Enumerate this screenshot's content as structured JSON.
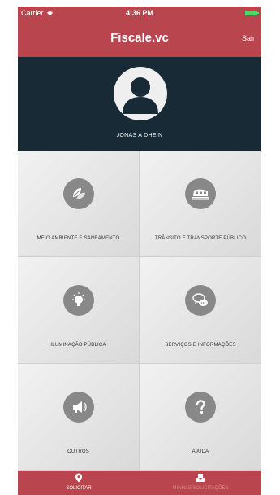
{
  "status_bar": {
    "carrier": "Carrier",
    "time": "4:36 PM"
  },
  "nav": {
    "title": "Fiscale.vc",
    "logout_label": "Sair"
  },
  "profile": {
    "name": "JONAS A DHEIN"
  },
  "categories": [
    {
      "label": "MEIO AMBIENTE E SANEAMENTO",
      "icon": "leaves-icon"
    },
    {
      "label": "TRÂNSITO E TRANSPORTE PÚBLICO",
      "icon": "train-icon"
    },
    {
      "label": "ILUMINAÇÃO PÚBLICA",
      "icon": "lightbulb-icon"
    },
    {
      "label": "SERVIÇOS E INFORMAÇÕES",
      "icon": "chat-bubbles-icon"
    },
    {
      "label": "OUTROS",
      "icon": "megaphone-icon"
    },
    {
      "label": "AJUDA",
      "icon": "question-icon"
    }
  ],
  "tabs": [
    {
      "label": "SOLICITAR",
      "icon": "location-pin-icon",
      "active": true
    },
    {
      "label": "MINHAS SOLICITAÇÕES",
      "icon": "inbox-icon",
      "active": false
    }
  ],
  "colors": {
    "accent": "#b9464f",
    "profile_background": "#172a36",
    "icon_circle": "#888888",
    "tab_inactive_text": "#d98a90"
  }
}
